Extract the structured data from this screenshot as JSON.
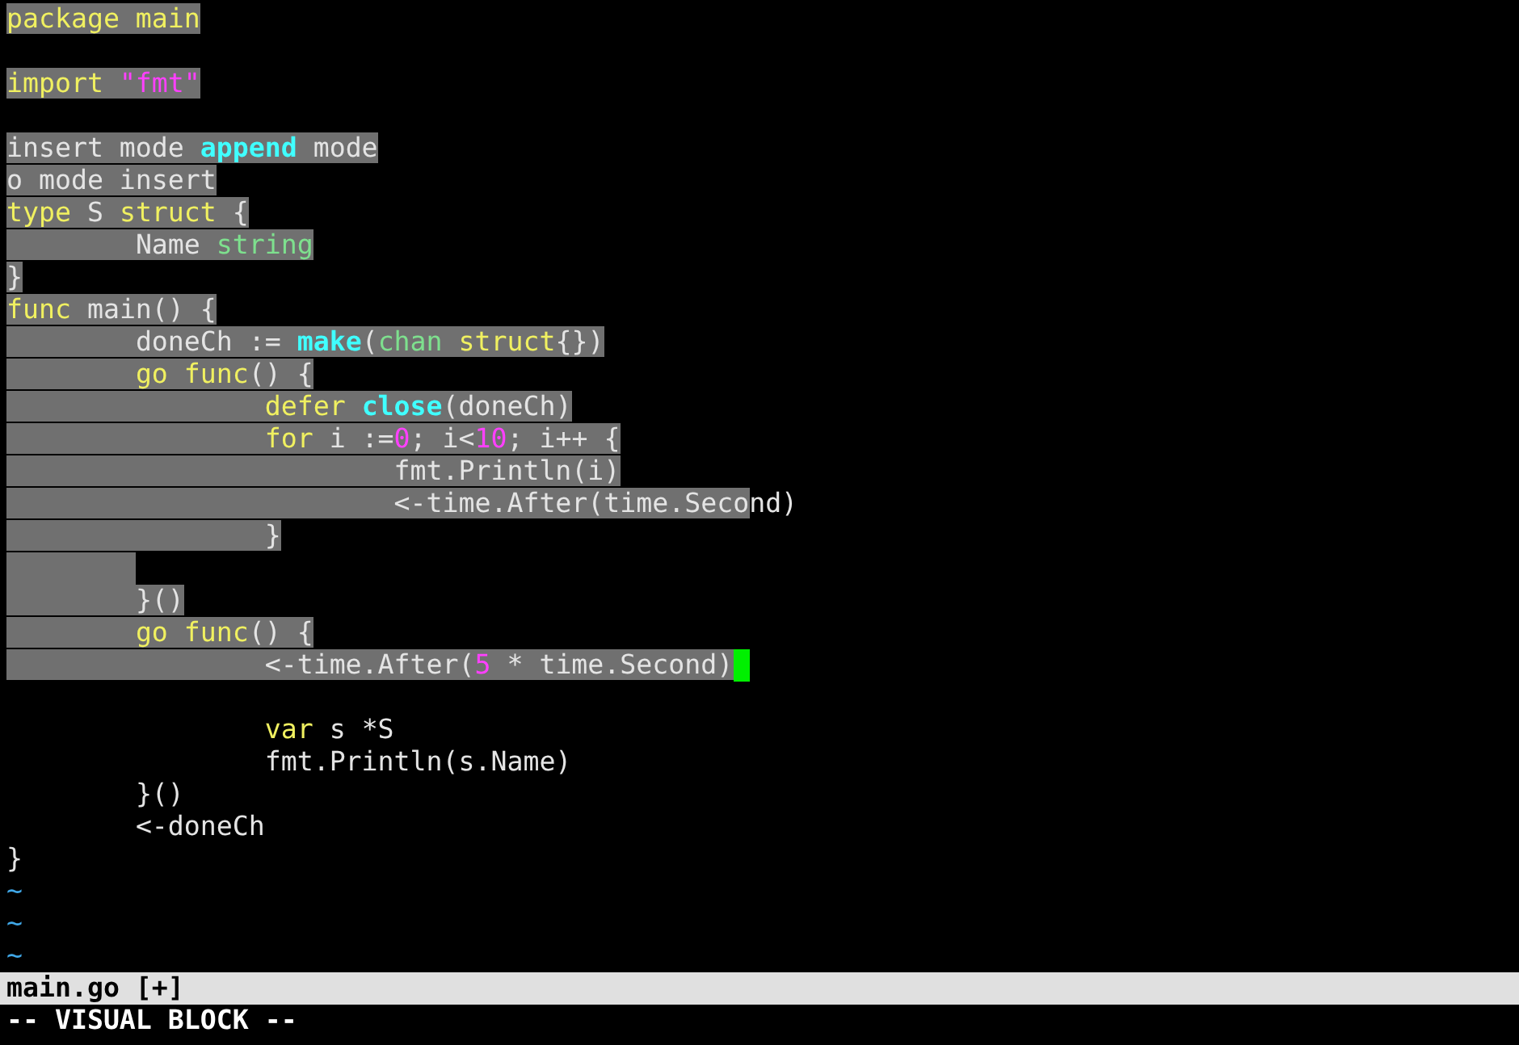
{
  "lines": [
    {
      "kind": "code",
      "cursor": false,
      "tokens": [
        {
          "text": "package main",
          "kind": "keyword",
          "selected": true
        }
      ]
    },
    {
      "kind": "blank"
    },
    {
      "kind": "code",
      "cursor": false,
      "tokens": [
        {
          "text": "import ",
          "kind": "keyword",
          "selected": true
        },
        {
          "text": "\"fmt\"",
          "kind": "constant",
          "selected": true
        }
      ]
    },
    {
      "kind": "blank"
    },
    {
      "kind": "code",
      "cursor": false,
      "tokens": [
        {
          "text": "insert mode ",
          "kind": "plain",
          "selected": true
        },
        {
          "text": "append",
          "kind": "builtin",
          "selected": true
        },
        {
          "text": " mode",
          "kind": "plain",
          "selected": true
        }
      ]
    },
    {
      "kind": "code",
      "cursor": false,
      "tokens": [
        {
          "text": "o mode insert",
          "kind": "plain",
          "selected": true
        }
      ]
    },
    {
      "kind": "code",
      "cursor": false,
      "tokens": [
        {
          "text": "type",
          "kind": "keyword",
          "selected": true
        },
        {
          "text": " S ",
          "kind": "plain",
          "selected": true
        },
        {
          "text": "struct",
          "kind": "keyword",
          "selected": true
        },
        {
          "text": " {",
          "kind": "plain",
          "selected": true
        }
      ]
    },
    {
      "kind": "code",
      "cursor": false,
      "tokens": [
        {
          "text": "\tName ",
          "kind": "plain",
          "selected": true
        },
        {
          "text": "string",
          "kind": "type",
          "selected": true
        }
      ]
    },
    {
      "kind": "code",
      "cursor": false,
      "tokens": [
        {
          "text": "}",
          "kind": "plain",
          "selected": true
        }
      ]
    },
    {
      "kind": "code",
      "cursor": false,
      "tokens": [
        {
          "text": "func",
          "kind": "keyword",
          "selected": true
        },
        {
          "text": " main() {",
          "kind": "plain",
          "selected": true
        }
      ]
    },
    {
      "kind": "code",
      "cursor": false,
      "tokens": [
        {
          "text": "\tdoneCh := ",
          "kind": "plain",
          "selected": true
        },
        {
          "text": "make",
          "kind": "builtin",
          "selected": true
        },
        {
          "text": "(",
          "kind": "plain",
          "selected": true
        },
        {
          "text": "chan ",
          "kind": "type",
          "selected": true
        },
        {
          "text": "struct",
          "kind": "keyword",
          "selected": true
        },
        {
          "text": "{})",
          "kind": "plain",
          "selected": true
        }
      ]
    },
    {
      "kind": "code",
      "cursor": false,
      "tokens": [
        {
          "text": "\tgo func",
          "kind": "keyword",
          "selected": true
        },
        {
          "text": "() {",
          "kind": "plain",
          "selected": true
        }
      ]
    },
    {
      "kind": "code",
      "cursor": false,
      "tokens": [
        {
          "text": "\t\tdefer ",
          "kind": "keyword",
          "selected": true
        },
        {
          "text": "close",
          "kind": "builtin",
          "selected": true
        },
        {
          "text": "(doneCh)",
          "kind": "plain",
          "selected": true
        }
      ]
    },
    {
      "kind": "code",
      "cursor": false,
      "tokens": [
        {
          "text": "\t\tfor",
          "kind": "keyword",
          "selected": true
        },
        {
          "text": " i :=",
          "kind": "plain",
          "selected": true
        },
        {
          "text": "0",
          "kind": "constant",
          "selected": true
        },
        {
          "text": "; i<",
          "kind": "plain",
          "selected": true
        },
        {
          "text": "10",
          "kind": "constant",
          "selected": true
        },
        {
          "text": "; i++ {",
          "kind": "plain",
          "selected": true
        }
      ]
    },
    {
      "kind": "code",
      "cursor": false,
      "tokens": [
        {
          "text": "\t\t\tfmt.Println(i)",
          "kind": "plain",
          "selected": true
        }
      ]
    },
    {
      "kind": "code",
      "cursor": false,
      "tokens": [
        {
          "text": "\t\t\t<-time.After(time.Seco",
          "kind": "plain",
          "selected": true
        },
        {
          "text": "nd)",
          "kind": "plain",
          "selected": false
        }
      ]
    },
    {
      "kind": "code",
      "cursor": false,
      "tokens": [
        {
          "text": "\t\t}",
          "kind": "plain",
          "selected": true
        }
      ]
    },
    {
      "kind": "tab_only",
      "selected": true
    },
    {
      "kind": "code",
      "cursor": false,
      "tokens": [
        {
          "text": "\t}()",
          "kind": "plain",
          "selected": true
        }
      ]
    },
    {
      "kind": "code",
      "cursor": false,
      "tokens": [
        {
          "text": "\tgo func",
          "kind": "keyword",
          "selected": true
        },
        {
          "text": "() {",
          "kind": "plain",
          "selected": true
        }
      ]
    },
    {
      "kind": "code",
      "cursor": true,
      "tokens": [
        {
          "text": "\t\t<-time.After(",
          "kind": "plain",
          "selected": true
        },
        {
          "text": "5",
          "kind": "constant",
          "selected": true
        },
        {
          "text": " * time.Second)",
          "kind": "plain",
          "selected": true
        }
      ]
    },
    {
      "kind": "blank"
    },
    {
      "kind": "code",
      "cursor": false,
      "tokens": [
        {
          "text": "\t\tvar",
          "kind": "keyword",
          "selected": false
        },
        {
          "text": " s *S",
          "kind": "plain",
          "selected": false
        }
      ]
    },
    {
      "kind": "code",
      "cursor": false,
      "tokens": [
        {
          "text": "\t\tfmt.Println(s.Name)",
          "kind": "plain",
          "selected": false
        }
      ]
    },
    {
      "kind": "code",
      "cursor": false,
      "tokens": [
        {
          "text": "\t}()",
          "kind": "plain",
          "selected": false
        }
      ]
    },
    {
      "kind": "code",
      "cursor": false,
      "tokens": [
        {
          "text": "\t<-doneCh",
          "kind": "plain",
          "selected": false
        }
      ]
    },
    {
      "kind": "code",
      "cursor": false,
      "tokens": [
        {
          "text": "}",
          "kind": "plain",
          "selected": false
        }
      ]
    }
  ],
  "filler_lines": [
    "~",
    "~",
    "~"
  ],
  "status_bar": {
    "file": "main.go [+]"
  },
  "mode_line": "-- VISUAL BLOCK --"
}
